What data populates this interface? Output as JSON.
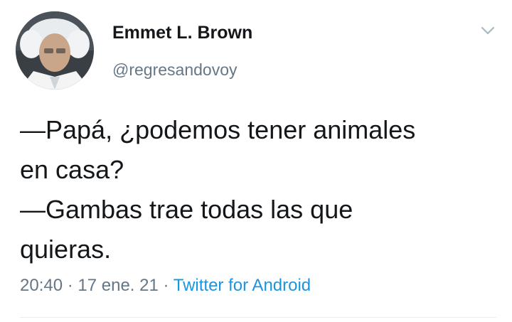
{
  "author": {
    "name": "Emmet L. Brown",
    "handle": "@regresandovoy"
  },
  "tweet": {
    "lines": [
      "—Papá, ¿podemos tener animales",
      "en casa?",
      "—Gambas trae todas las que",
      "quieras."
    ]
  },
  "meta": {
    "time": "20:40",
    "date": "17 ene. 21",
    "separator": " · ",
    "source": "Twitter for Android"
  },
  "icons": {
    "menu": "chevron-down-icon"
  },
  "colors": {
    "text": "#14171a",
    "secondary": "#657786",
    "link": "#1b95e0",
    "divider": "#e6ecf0"
  }
}
